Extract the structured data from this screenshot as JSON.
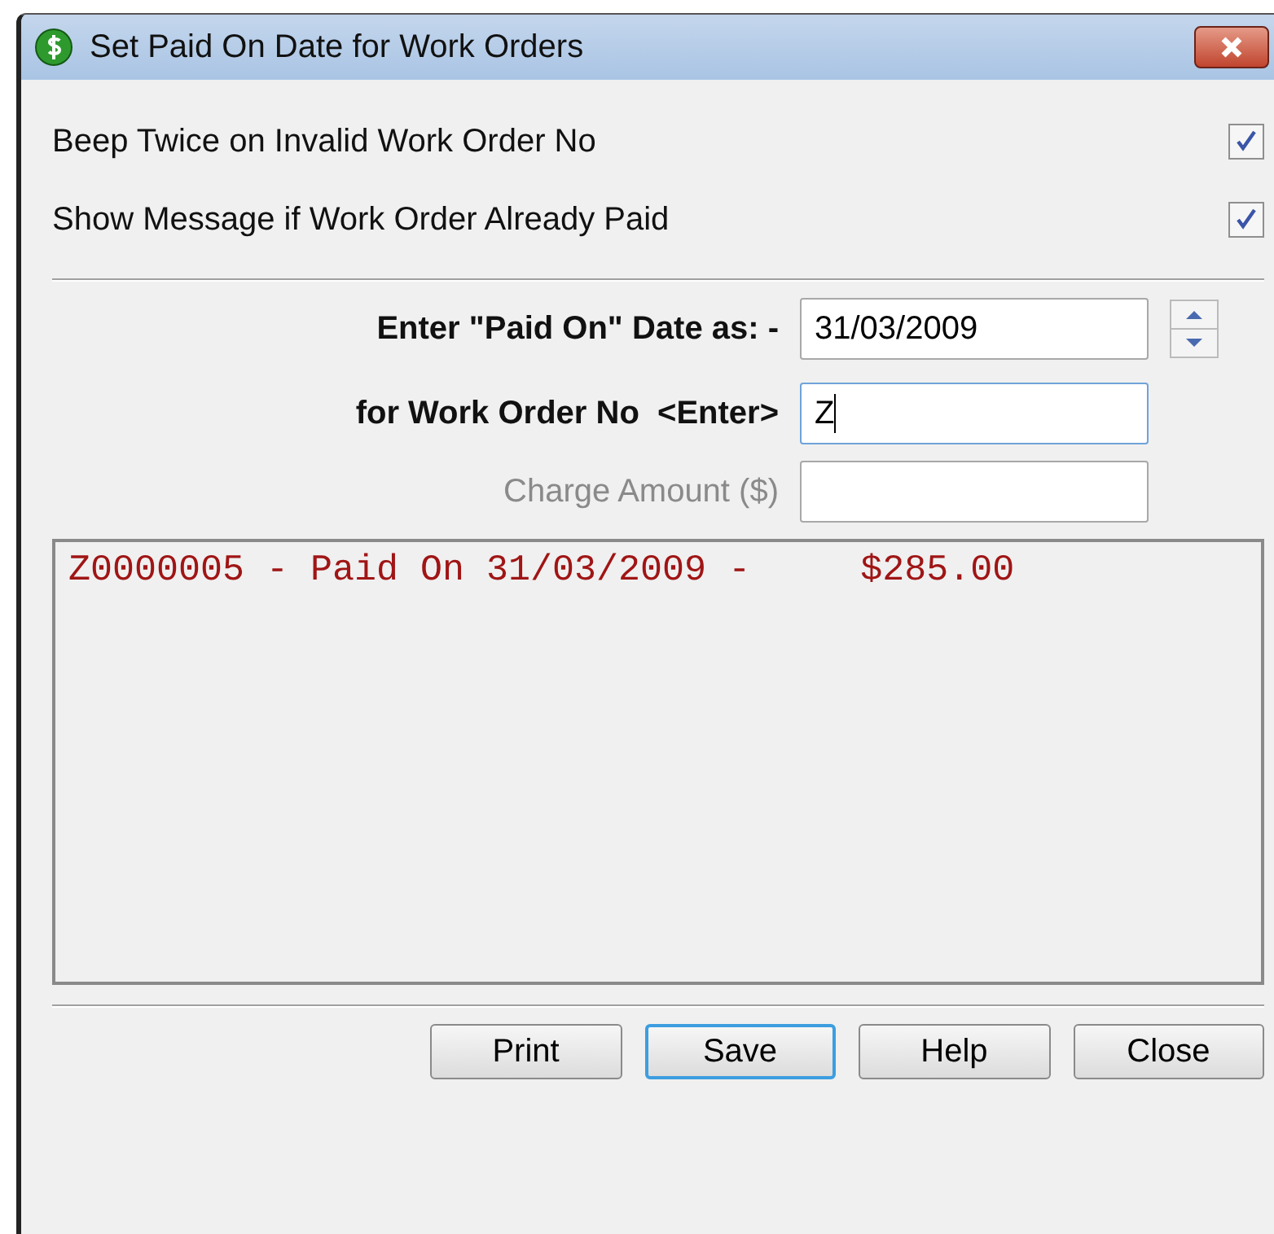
{
  "window": {
    "title": "Set Paid On Date for Work Orders"
  },
  "options": [
    {
      "label": "Beep Twice on Invalid Work Order No",
      "checked": true
    },
    {
      "label": "Show Message if Work Order Already Paid",
      "checked": true
    }
  ],
  "fields": [
    {
      "kind": "date",
      "label": "Enter \"Paid On\" Date as: -",
      "value": "31/03/2009",
      "disabled": false,
      "focused": false
    },
    {
      "kind": "text",
      "label": "for Work Order No  <Enter>",
      "value": "Z",
      "disabled": false,
      "focused": true
    },
    {
      "kind": "text",
      "label": "Charge Amount ($)",
      "disabled": true,
      "focused": false
    }
  ],
  "log": [
    {
      "text": "Z0000005 - Paid On 31/03/2009 -     $285.00"
    }
  ],
  "buttons": [
    {
      "label": "Print",
      "selected": false
    },
    {
      "label": "Save",
      "selected": true
    },
    {
      "label": "Help",
      "selected": false
    },
    {
      "label": "Close",
      "selected": false
    }
  ]
}
